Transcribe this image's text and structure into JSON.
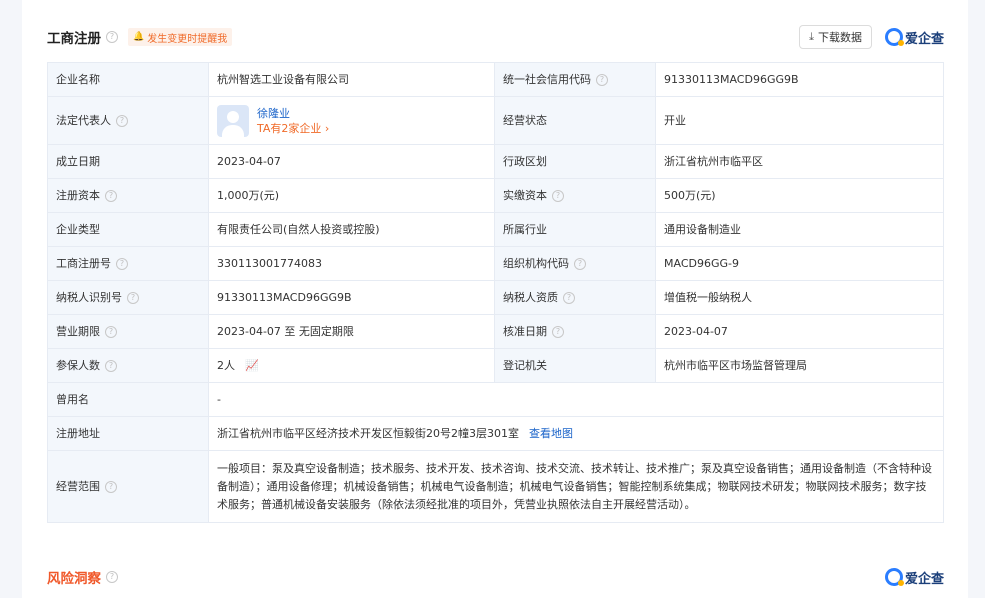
{
  "section": {
    "title": "工商注册",
    "remind": "发生变更时提醒我",
    "download": "下载数据",
    "brand": "爱企查"
  },
  "rows": {
    "company_name": {
      "label": "企业名称",
      "value": "杭州智选工业设备有限公司"
    },
    "credit_code": {
      "label": "统一社会信用代码",
      "value": "91330113MACD96GG9B"
    },
    "legal_rep": {
      "label": "法定代表人",
      "name": "徐隆业",
      "sub": "TA有2家企业 ›"
    },
    "status": {
      "label": "经营状态",
      "value": "开业"
    },
    "founded": {
      "label": "成立日期",
      "value": "2023-04-07"
    },
    "region": {
      "label": "行政区划",
      "value": "浙江省杭州市临平区"
    },
    "reg_capital": {
      "label": "注册资本",
      "value": "1,000万(元)"
    },
    "paid_capital": {
      "label": "实缴资本",
      "value": "500万(元)"
    },
    "company_type": {
      "label": "企业类型",
      "value": "有限责任公司(自然人投资或控股)"
    },
    "industry": {
      "label": "所属行业",
      "value": "通用设备制造业"
    },
    "reg_no": {
      "label": "工商注册号",
      "value": "330113001774083"
    },
    "org_code": {
      "label": "组织机构代码",
      "value": "MACD96GG-9"
    },
    "taxpayer_id": {
      "label": "纳税人识别号",
      "value": "91330113MACD96GG9B"
    },
    "taxpayer_type": {
      "label": "纳税人资质",
      "value": "增值税一般纳税人"
    },
    "term": {
      "label": "营业期限",
      "value": "2023-04-07 至 无固定期限"
    },
    "approve_date": {
      "label": "核准日期",
      "value": "2023-04-07"
    },
    "insured": {
      "label": "参保人数",
      "value": "2人"
    },
    "authority": {
      "label": "登记机关",
      "value": "杭州市临平区市场监督管理局"
    },
    "former_name": {
      "label": "曾用名",
      "value": "-"
    },
    "address": {
      "label": "注册地址",
      "value": "浙江省杭州市临平区经济技术开发区恒毅街20号2幢3层301室",
      "link": "查看地图"
    },
    "scope": {
      "label": "经营范围",
      "value": "一般项目：泵及真空设备制造；技术服务、技术开发、技术咨询、技术交流、技术转让、技术推广；泵及真空设备销售；通用设备制造（不含特种设备制造）；通用设备修理；机械设备销售；机械电气设备制造；机械电气设备销售；智能控制系统集成；物联网技术研发；物联网技术服务；数字技术服务；普通机械设备安装服务（除依法须经批准的项目外，凭营业执照依法自主开展经营活动）。"
    }
  },
  "risk": {
    "title": "风险洞察",
    "brand": "爱企查"
  }
}
